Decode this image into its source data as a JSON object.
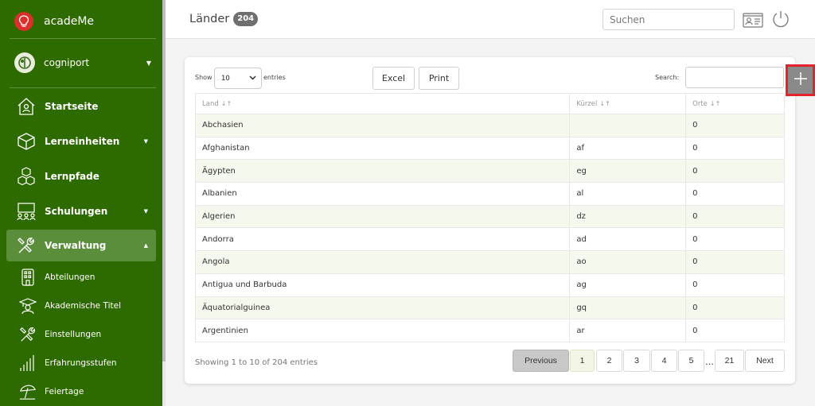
{
  "app": {
    "name": "acadeMe"
  },
  "org": {
    "name": "cogniport"
  },
  "nav": {
    "items": [
      {
        "label": "Startseite",
        "icon": "home-icon"
      },
      {
        "label": "Lerneinheiten",
        "icon": "cube-icon"
      },
      {
        "label": "Lernpfade",
        "icon": "cubes-icon"
      },
      {
        "label": "Schulungen",
        "icon": "classroom-icon"
      },
      {
        "label": "Verwaltung",
        "icon": "tools-icon"
      }
    ],
    "sub_items": [
      {
        "label": "Abteilungen",
        "icon": "building-icon"
      },
      {
        "label": "Akademische Titel",
        "icon": "graduate-icon"
      },
      {
        "label": "Einstellungen",
        "icon": "tools-icon"
      },
      {
        "label": "Erfahrungsstufen",
        "icon": "bars-icon"
      },
      {
        "label": "Feiertage",
        "icon": "beach-umbrella-icon"
      }
    ]
  },
  "header": {
    "title": "Länder",
    "count": "204",
    "search_placeholder": "Suchen"
  },
  "table_controls": {
    "show_label": "Show",
    "page_length": "10",
    "entries_label": "entries",
    "excel_label": "Excel",
    "print_label": "Print",
    "search_label": "Search:"
  },
  "table": {
    "columns": [
      "Land",
      "Kürzel",
      "Orte"
    ],
    "rows": [
      [
        "Abchasien",
        "",
        "0"
      ],
      [
        "Afghanistan",
        "af",
        "0"
      ],
      [
        "Ägypten",
        "eg",
        "0"
      ],
      [
        "Albanien",
        "al",
        "0"
      ],
      [
        "Algerien",
        "dz",
        "0"
      ],
      [
        "Andorra",
        "ad",
        "0"
      ],
      [
        "Angola",
        "ao",
        "0"
      ],
      [
        "Antigua und Barbuda",
        "ag",
        "0"
      ],
      [
        "Äquatorialguinea",
        "gq",
        "0"
      ],
      [
        "Argentinien",
        "ar",
        "0"
      ]
    ]
  },
  "pagination": {
    "info": "Showing 1 to 10 of 204 entries",
    "previous": "Previous",
    "pages": [
      "1",
      "2",
      "3",
      "4",
      "5",
      "21"
    ],
    "ellipsis": "…",
    "next": "Next"
  },
  "colors": {
    "sidebar": "#2d6a00",
    "active_nav": "#5b8e3a",
    "row_stripe": "#f5f8ec",
    "add_button_outline": "#e5232a"
  }
}
